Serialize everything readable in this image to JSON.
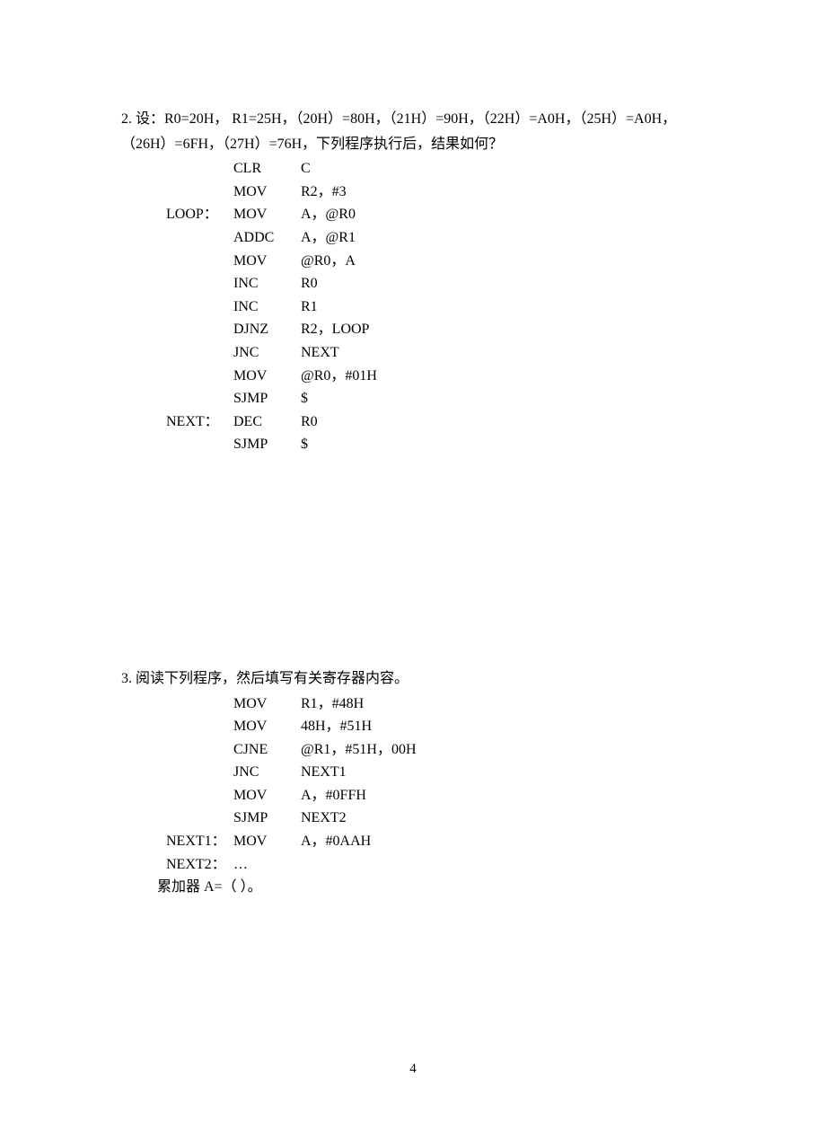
{
  "q2": {
    "intro_line1": "2. 设：R0=20H， R1=25H，（20H）=80H，（21H）=90H，（22H）=A0H，（25H）=A0H，",
    "intro_line2": "（26H）=6FH，（27H）=76H，下列程序执行后，结果如何？",
    "code": [
      {
        "label": "",
        "mnemonic": "CLR",
        "operand": "C"
      },
      {
        "label": "",
        "mnemonic": "MOV",
        "operand": "R2，#3"
      },
      {
        "label": "LOOP：",
        "mnemonic": "MOV",
        "operand": "A，@R0"
      },
      {
        "label": "",
        "mnemonic": "ADDC",
        "operand": "A，@R1"
      },
      {
        "label": "",
        "mnemonic": "MOV",
        "operand": "@R0，A"
      },
      {
        "label": "",
        "mnemonic": "INC",
        "operand": "R0"
      },
      {
        "label": "",
        "mnemonic": "INC",
        "operand": "R1"
      },
      {
        "label": "",
        "mnemonic": "DJNZ",
        "operand": "R2，LOOP"
      },
      {
        "label": "",
        "mnemonic": "JNC",
        "operand": "NEXT"
      },
      {
        "label": "",
        "mnemonic": "MOV",
        "operand": "@R0，#01H"
      },
      {
        "label": "",
        "mnemonic": "SJMP",
        "operand": "$"
      },
      {
        "label": "NEXT：",
        "mnemonic": "DEC",
        "operand": "R0"
      },
      {
        "label": "",
        "mnemonic": "SJMP",
        "operand": "$"
      }
    ]
  },
  "q3": {
    "intro": "3. 阅读下列程序，然后填写有关寄存器内容。",
    "code": [
      {
        "label": "",
        "mnemonic": "MOV",
        "operand": "R1，#48H"
      },
      {
        "label": "",
        "mnemonic": "MOV",
        "operand": "48H，#51H"
      },
      {
        "label": "",
        "mnemonic": "CJNE",
        "operand": "@R1，#51H，00H"
      },
      {
        "label": "",
        "mnemonic": "JNC",
        "operand": "NEXT1"
      },
      {
        "label": "",
        "mnemonic": "MOV",
        "operand": "A，#0FFH"
      },
      {
        "label": "",
        "mnemonic": "SJMP",
        "operand": "NEXT2"
      },
      {
        "label": "NEXT1：",
        "mnemonic": "MOV",
        "operand": "A，#0AAH"
      },
      {
        "label": "NEXT2：",
        "mnemonic": "…",
        "operand": ""
      }
    ],
    "answer_line": "累加器 A=（               ）。"
  },
  "page_number": "4"
}
